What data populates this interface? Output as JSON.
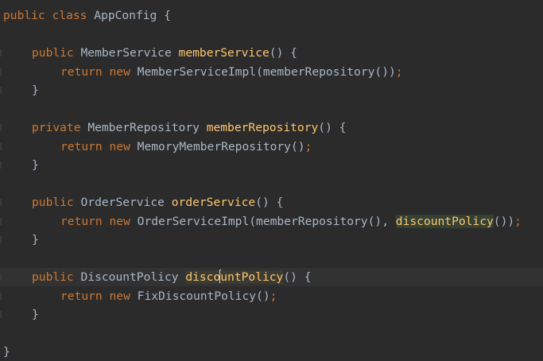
{
  "editor": {
    "lines": [
      {
        "tokens": [
          {
            "t": "kw",
            "v": "public"
          },
          {
            "t": "sp",
            "v": " "
          },
          {
            "t": "kw",
            "v": "class"
          },
          {
            "t": "sp",
            "v": " "
          },
          {
            "t": "type",
            "v": "AppConfig"
          },
          {
            "t": "sp",
            "v": " "
          },
          {
            "t": "punc",
            "v": "{"
          }
        ],
        "indent": 0
      },
      {
        "tokens": [],
        "indent": 0
      },
      {
        "tokens": [
          {
            "t": "kw",
            "v": "public"
          },
          {
            "t": "sp",
            "v": " "
          },
          {
            "t": "type",
            "v": "MemberService"
          },
          {
            "t": "sp",
            "v": " "
          },
          {
            "t": "fn",
            "v": "memberService"
          },
          {
            "t": "punc",
            "v": "() {"
          }
        ],
        "indent": 1
      },
      {
        "tokens": [
          {
            "t": "kw",
            "v": "return"
          },
          {
            "t": "sp",
            "v": " "
          },
          {
            "t": "kw",
            "v": "new"
          },
          {
            "t": "sp",
            "v": " "
          },
          {
            "t": "type",
            "v": "MemberServiceImpl"
          },
          {
            "t": "punc",
            "v": "(memberRepository())"
          },
          {
            "t": "semi",
            "v": ";"
          }
        ],
        "indent": 2
      },
      {
        "tokens": [
          {
            "t": "punc",
            "v": "}"
          }
        ],
        "indent": 1
      },
      {
        "tokens": [],
        "indent": 0
      },
      {
        "tokens": [
          {
            "t": "kw",
            "v": "private"
          },
          {
            "t": "sp",
            "v": " "
          },
          {
            "t": "type",
            "v": "MemberRepository"
          },
          {
            "t": "sp",
            "v": " "
          },
          {
            "t": "fn",
            "v": "memberRepository"
          },
          {
            "t": "punc",
            "v": "() {"
          }
        ],
        "indent": 1
      },
      {
        "tokens": [
          {
            "t": "kw",
            "v": "return"
          },
          {
            "t": "sp",
            "v": " "
          },
          {
            "t": "kw",
            "v": "new"
          },
          {
            "t": "sp",
            "v": " "
          },
          {
            "t": "type",
            "v": "MemoryMemberRepository"
          },
          {
            "t": "punc",
            "v": "()"
          },
          {
            "t": "semi",
            "v": ";"
          }
        ],
        "indent": 2
      },
      {
        "tokens": [
          {
            "t": "punc",
            "v": "}"
          }
        ],
        "indent": 1
      },
      {
        "tokens": [],
        "indent": 0
      },
      {
        "tokens": [
          {
            "t": "kw",
            "v": "public"
          },
          {
            "t": "sp",
            "v": " "
          },
          {
            "t": "type",
            "v": "OrderService"
          },
          {
            "t": "sp",
            "v": " "
          },
          {
            "t": "fn",
            "v": "orderService"
          },
          {
            "t": "punc",
            "v": "() {"
          }
        ],
        "indent": 1
      },
      {
        "tokens": [
          {
            "t": "kw",
            "v": "return"
          },
          {
            "t": "sp",
            "v": " "
          },
          {
            "t": "kw",
            "v": "new"
          },
          {
            "t": "sp",
            "v": " "
          },
          {
            "t": "type",
            "v": "OrderServiceImpl"
          },
          {
            "t": "punc",
            "v": "(memberRepository(), "
          },
          {
            "t": "hl",
            "v": "discountPolicy"
          },
          {
            "t": "punc",
            "v": "())"
          },
          {
            "t": "semi",
            "v": ";"
          }
        ],
        "indent": 2
      },
      {
        "tokens": [
          {
            "t": "punc",
            "v": "}"
          }
        ],
        "indent": 1
      },
      {
        "tokens": [],
        "indent": 0
      },
      {
        "tokens": [
          {
            "t": "kw",
            "v": "public"
          },
          {
            "t": "sp",
            "v": " "
          },
          {
            "t": "type",
            "v": "DiscountPolicy"
          },
          {
            "t": "sp",
            "v": " "
          },
          {
            "t": "fnc1",
            "v": "disco"
          },
          {
            "t": "caret",
            "v": ""
          },
          {
            "t": "fnc2",
            "v": "untPolicy"
          },
          {
            "t": "punc",
            "v": "() {"
          }
        ],
        "indent": 1,
        "current": true
      },
      {
        "tokens": [
          {
            "t": "kw",
            "v": "return"
          },
          {
            "t": "sp",
            "v": " "
          },
          {
            "t": "kw",
            "v": "new"
          },
          {
            "t": "sp",
            "v": " "
          },
          {
            "t": "type",
            "v": "FixDiscountPolicy"
          },
          {
            "t": "punc",
            "v": "()"
          },
          {
            "t": "semi",
            "v": ";"
          }
        ],
        "indent": 2
      },
      {
        "tokens": [
          {
            "t": "punc",
            "v": "}"
          }
        ],
        "indent": 1
      },
      {
        "tokens": [],
        "indent": 0
      },
      {
        "tokens": [
          {
            "t": "punc",
            "v": "}"
          }
        ],
        "indent": 0
      }
    ]
  }
}
